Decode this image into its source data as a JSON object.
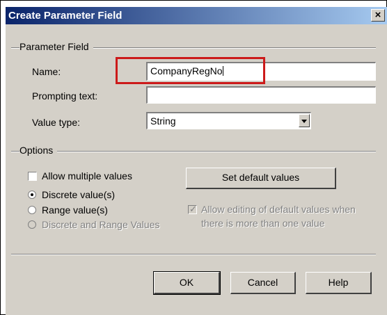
{
  "window": {
    "title": "Create Parameter Field",
    "close_glyph": "×"
  },
  "parameter_field": {
    "group_label": "Parameter Field",
    "name_label": "Name:",
    "name_value": "CompanyRegNo",
    "prompting_label": "Prompting text:",
    "prompting_value": "",
    "value_type_label": "Value type:",
    "value_type_selected": "String"
  },
  "options": {
    "group_label": "Options",
    "allow_multiple_label": "Allow multiple values",
    "allow_multiple_checked": false,
    "set_default_label": "Set default values",
    "radio_discrete": "Discrete value(s)",
    "radio_range": "Range value(s)",
    "radio_both": "Discrete and Range Values",
    "selected_radio": "Discrete value(s)",
    "allow_editing_line1": "Allow editing of default values when",
    "allow_editing_line2": "there is more than one value"
  },
  "buttons": {
    "ok": "OK",
    "cancel": "Cancel",
    "help": "Help"
  },
  "colors": {
    "highlight_box": "#cc1a1a",
    "title_start": "#0a246a",
    "title_end": "#a6caf0",
    "face": "#d4d0c8"
  }
}
